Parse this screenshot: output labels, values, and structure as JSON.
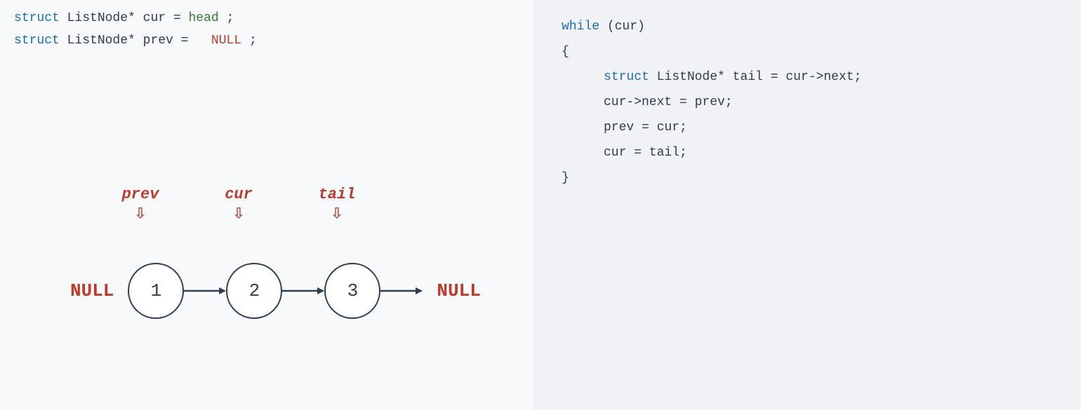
{
  "left": {
    "code_line1_kw": "struct",
    "code_line1_type": "ListNode*",
    "code_line1_var": "cur",
    "code_line1_val": "head",
    "code_line2_kw": "struct",
    "code_line2_type": "ListNode*",
    "code_line2_var": "prev",
    "code_line2_val": "NULL"
  },
  "right": {
    "while_kw": "while",
    "while_cond": "(cur)",
    "open_brace": "{",
    "line1_kw": "struct",
    "line1_type": "ListNode*",
    "line1_var": "tail",
    "line1_op": "=",
    "line1_val": "cur->next;",
    "line2": "cur->next = prev;",
    "line3": "prev = cur;",
    "line4": "cur = tail;",
    "close_brace": "}"
  },
  "diagram": {
    "label_prev": "prev",
    "label_cur": "cur",
    "label_tail": "tail",
    "null_left": "NULL",
    "null_right": "NULL",
    "node1": "1",
    "node2": "2",
    "node3": "3"
  },
  "colors": {
    "keyword_blue": "#1a6fa8",
    "keyword_green": "#2e7d2e",
    "red": "#c0392b",
    "dark": "#2c3e50"
  }
}
